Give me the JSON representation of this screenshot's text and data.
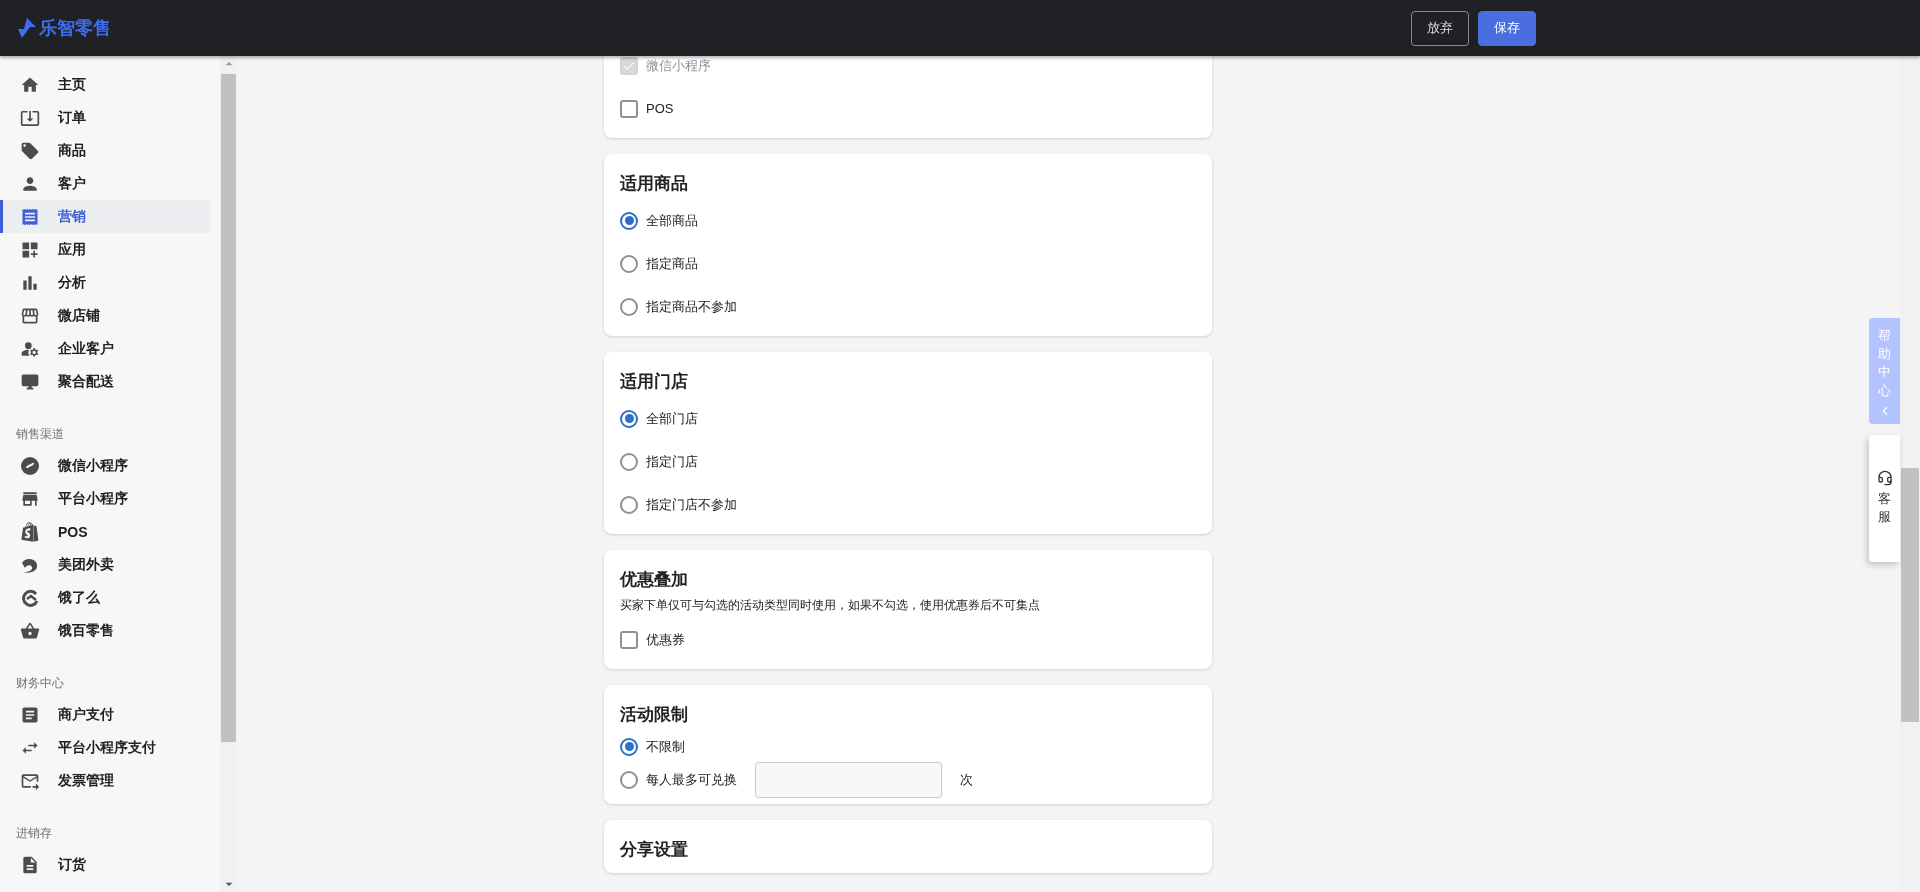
{
  "logo": {
    "text": "乐智零售"
  },
  "header_buttons": [
    {
      "label": "放弃",
      "kind": "secondary"
    },
    {
      "label": "保存",
      "kind": "primary"
    }
  ],
  "sidebar": {
    "groups": [
      {
        "items": [
          {
            "label": "主页",
            "selected": false
          },
          {
            "label": "订单",
            "selected": false
          },
          {
            "label": "商品",
            "selected": false
          },
          {
            "label": "客户",
            "selected": false
          },
          {
            "label": "营销",
            "selected": true
          },
          {
            "label": "应用",
            "selected": false
          },
          {
            "label": "分析",
            "selected": false
          },
          {
            "label": "微店铺",
            "selected": false
          },
          {
            "label": "企业客户",
            "selected": false
          },
          {
            "label": "聚合配送",
            "selected": false
          }
        ]
      },
      {
        "heading": "销售渠道",
        "items": [
          {
            "label": "微信小程序",
            "selected": false
          },
          {
            "label": "平台小程序",
            "selected": false
          },
          {
            "label": "POS",
            "selected": false
          },
          {
            "label": "美团外卖",
            "selected": false
          },
          {
            "label": "饿了么",
            "selected": false
          },
          {
            "label": "饿百零售",
            "selected": false
          }
        ]
      },
      {
        "heading": "财务中心",
        "items": [
          {
            "label": "商户支付",
            "selected": false
          },
          {
            "label": "平台小程序支付",
            "selected": false
          },
          {
            "label": "发票管理",
            "selected": false
          }
        ]
      },
      {
        "heading": "进销存",
        "items": [
          {
            "label": "订货",
            "selected": false
          }
        ]
      }
    ]
  },
  "cards": [
    {
      "options": [
        {
          "kind": "checkbox",
          "label": "微信小程序",
          "checked": true,
          "disabled": true
        },
        {
          "kind": "checkbox",
          "label": "POS",
          "checked": false,
          "disabled": false
        }
      ]
    },
    {
      "title": "适用商品",
      "options": [
        {
          "kind": "radio",
          "label": "全部商品",
          "selected": true
        },
        {
          "kind": "radio",
          "label": "指定商品",
          "selected": false
        },
        {
          "kind": "radio",
          "label": "指定商品不参加",
          "selected": false
        }
      ]
    },
    {
      "title": "适用门店",
      "options": [
        {
          "kind": "radio",
          "label": "全部门店",
          "selected": true
        },
        {
          "kind": "radio",
          "label": "指定门店",
          "selected": false
        },
        {
          "kind": "radio",
          "label": "指定门店不参加",
          "selected": false
        }
      ]
    },
    {
      "title": "优惠叠加",
      "description": "买家下单仅可与勾选的活动类型同时使用，如果不勾选，使用优惠券后不可集点",
      "options": [
        {
          "kind": "checkbox",
          "label": "优惠券",
          "checked": false,
          "disabled": false
        }
      ]
    },
    {
      "title": "活动限制",
      "options": [
        {
          "kind": "radio",
          "label": "不限制",
          "selected": true
        },
        {
          "kind": "radio",
          "label": "每人最多可兑换",
          "selected": false,
          "suffix": "次"
        }
      ]
    },
    {
      "title": "分享设置"
    }
  ],
  "help": {
    "tab": "帮助中心",
    "service": "客服"
  }
}
